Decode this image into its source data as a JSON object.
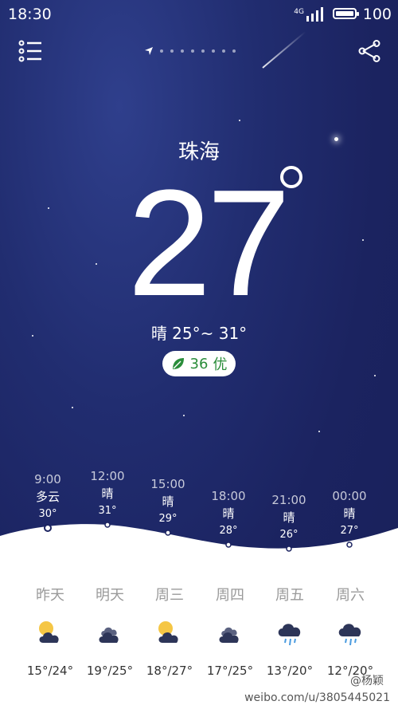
{
  "status_bar": {
    "time": "18:30",
    "network": "4G",
    "battery": "100"
  },
  "header": {
    "menu_icon": "list-menu-icon",
    "share_icon": "share-icon",
    "location_icon": "location-arrow-icon",
    "page_dots": 8
  },
  "current": {
    "city": "珠海",
    "temperature": "27",
    "condition_range": "晴  25°~ 31°",
    "aqi_value": "36",
    "aqi_label": "优",
    "aqi_color": "#2a8d3a"
  },
  "hourly": [
    {
      "time": "9:00",
      "condition": "多云",
      "temp": "30°"
    },
    {
      "time": "12:00",
      "condition": "晴",
      "temp": "31°"
    },
    {
      "time": "15:00",
      "condition": "晴",
      "temp": "29°"
    },
    {
      "time": "18:00",
      "condition": "晴",
      "temp": "28°"
    },
    {
      "time": "21:00",
      "condition": "晴",
      "temp": "26°"
    },
    {
      "time": "00:00",
      "condition": "晴",
      "temp": "27°"
    }
  ],
  "daily": [
    {
      "name": "昨天",
      "icon": "sun-cloud-icon",
      "range": "15°/24°"
    },
    {
      "name": "明天",
      "icon": "cloud-icon",
      "range": "19°/25°"
    },
    {
      "name": "周三",
      "icon": "sun-cloud-icon",
      "range": "18°/27°"
    },
    {
      "name": "周四",
      "icon": "cloud-icon",
      "range": "17°/25°"
    },
    {
      "name": "周五",
      "icon": "rain-icon",
      "range": "13°/20°"
    },
    {
      "name": "周六",
      "icon": "rain-icon",
      "range": "12°/20°"
    }
  ],
  "watermark": {
    "handle": "@杨颖",
    "url": "weibo.com/u/3805445021"
  }
}
